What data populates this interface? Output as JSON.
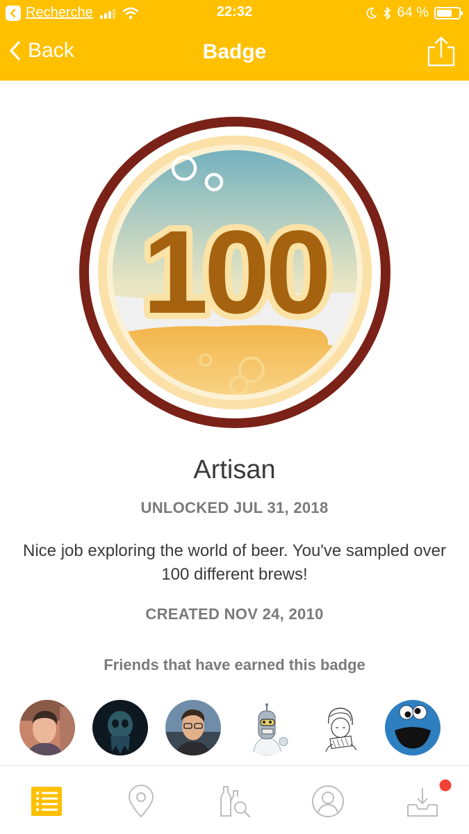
{
  "status_bar": {
    "back_app": "Recherche",
    "time": "22:32",
    "battery": "64 %"
  },
  "nav": {
    "back_label": "Back",
    "title": "Badge",
    "share_icon": "share-icon"
  },
  "badge": {
    "number": "100",
    "name": "Artisan",
    "unlocked": "UNLOCKED JUL 31, 2018",
    "description": "Nice job exploring the world of beer. You've sampled over 100 different brews!",
    "created": "CREATED NOV 24, 2010"
  },
  "friends": {
    "heading": "Friends that have earned this badge",
    "avatars": [
      "avatar-man-photo",
      "avatar-dark-skull",
      "avatar-man-glasses",
      "avatar-robot-cartoon",
      "avatar-sketch-drawing",
      "avatar-blue-monster"
    ]
  },
  "tabbar": {
    "tabs": [
      "list-icon",
      "location-pin-icon",
      "beer-search-icon",
      "profile-icon",
      "inbox-icon"
    ],
    "active_color": "#FFC000",
    "notification_color": "#F44336"
  },
  "colors": {
    "brand": "#FFC000",
    "badge_ring": "#7A2218"
  }
}
